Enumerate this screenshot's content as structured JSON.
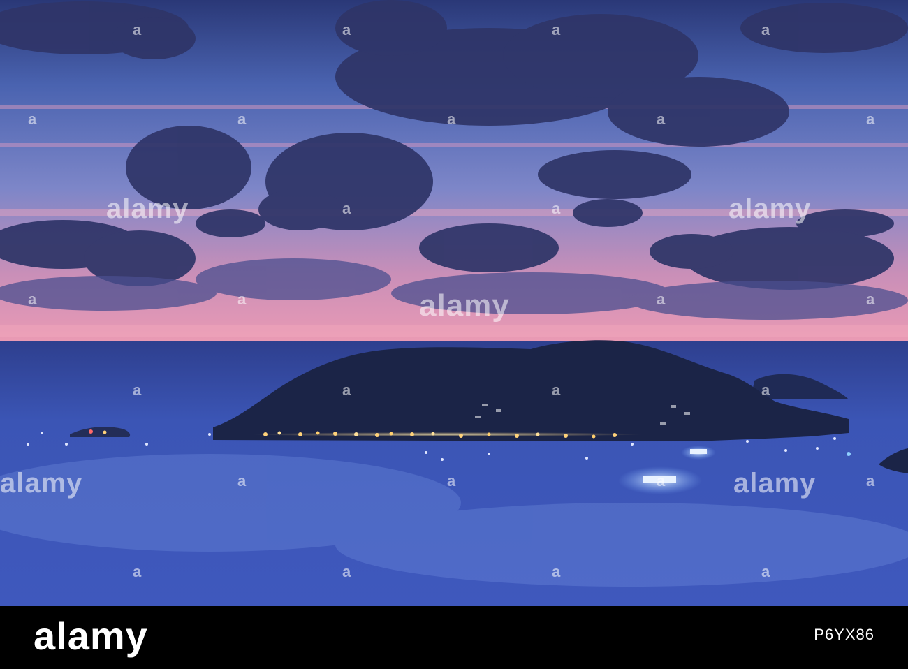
{
  "watermark": {
    "text": "alamy",
    "small_mark": "a"
  },
  "footer": {
    "logo": "alamy",
    "image_id": "P6YX86"
  },
  "colors": {
    "sky_top": "#2b3a78",
    "sky_mid": "#5a74c2",
    "horizon_pink": "#e89ab5",
    "sea": "#3d55b8",
    "island": "#1b2447",
    "lights": "#ffd27a"
  }
}
